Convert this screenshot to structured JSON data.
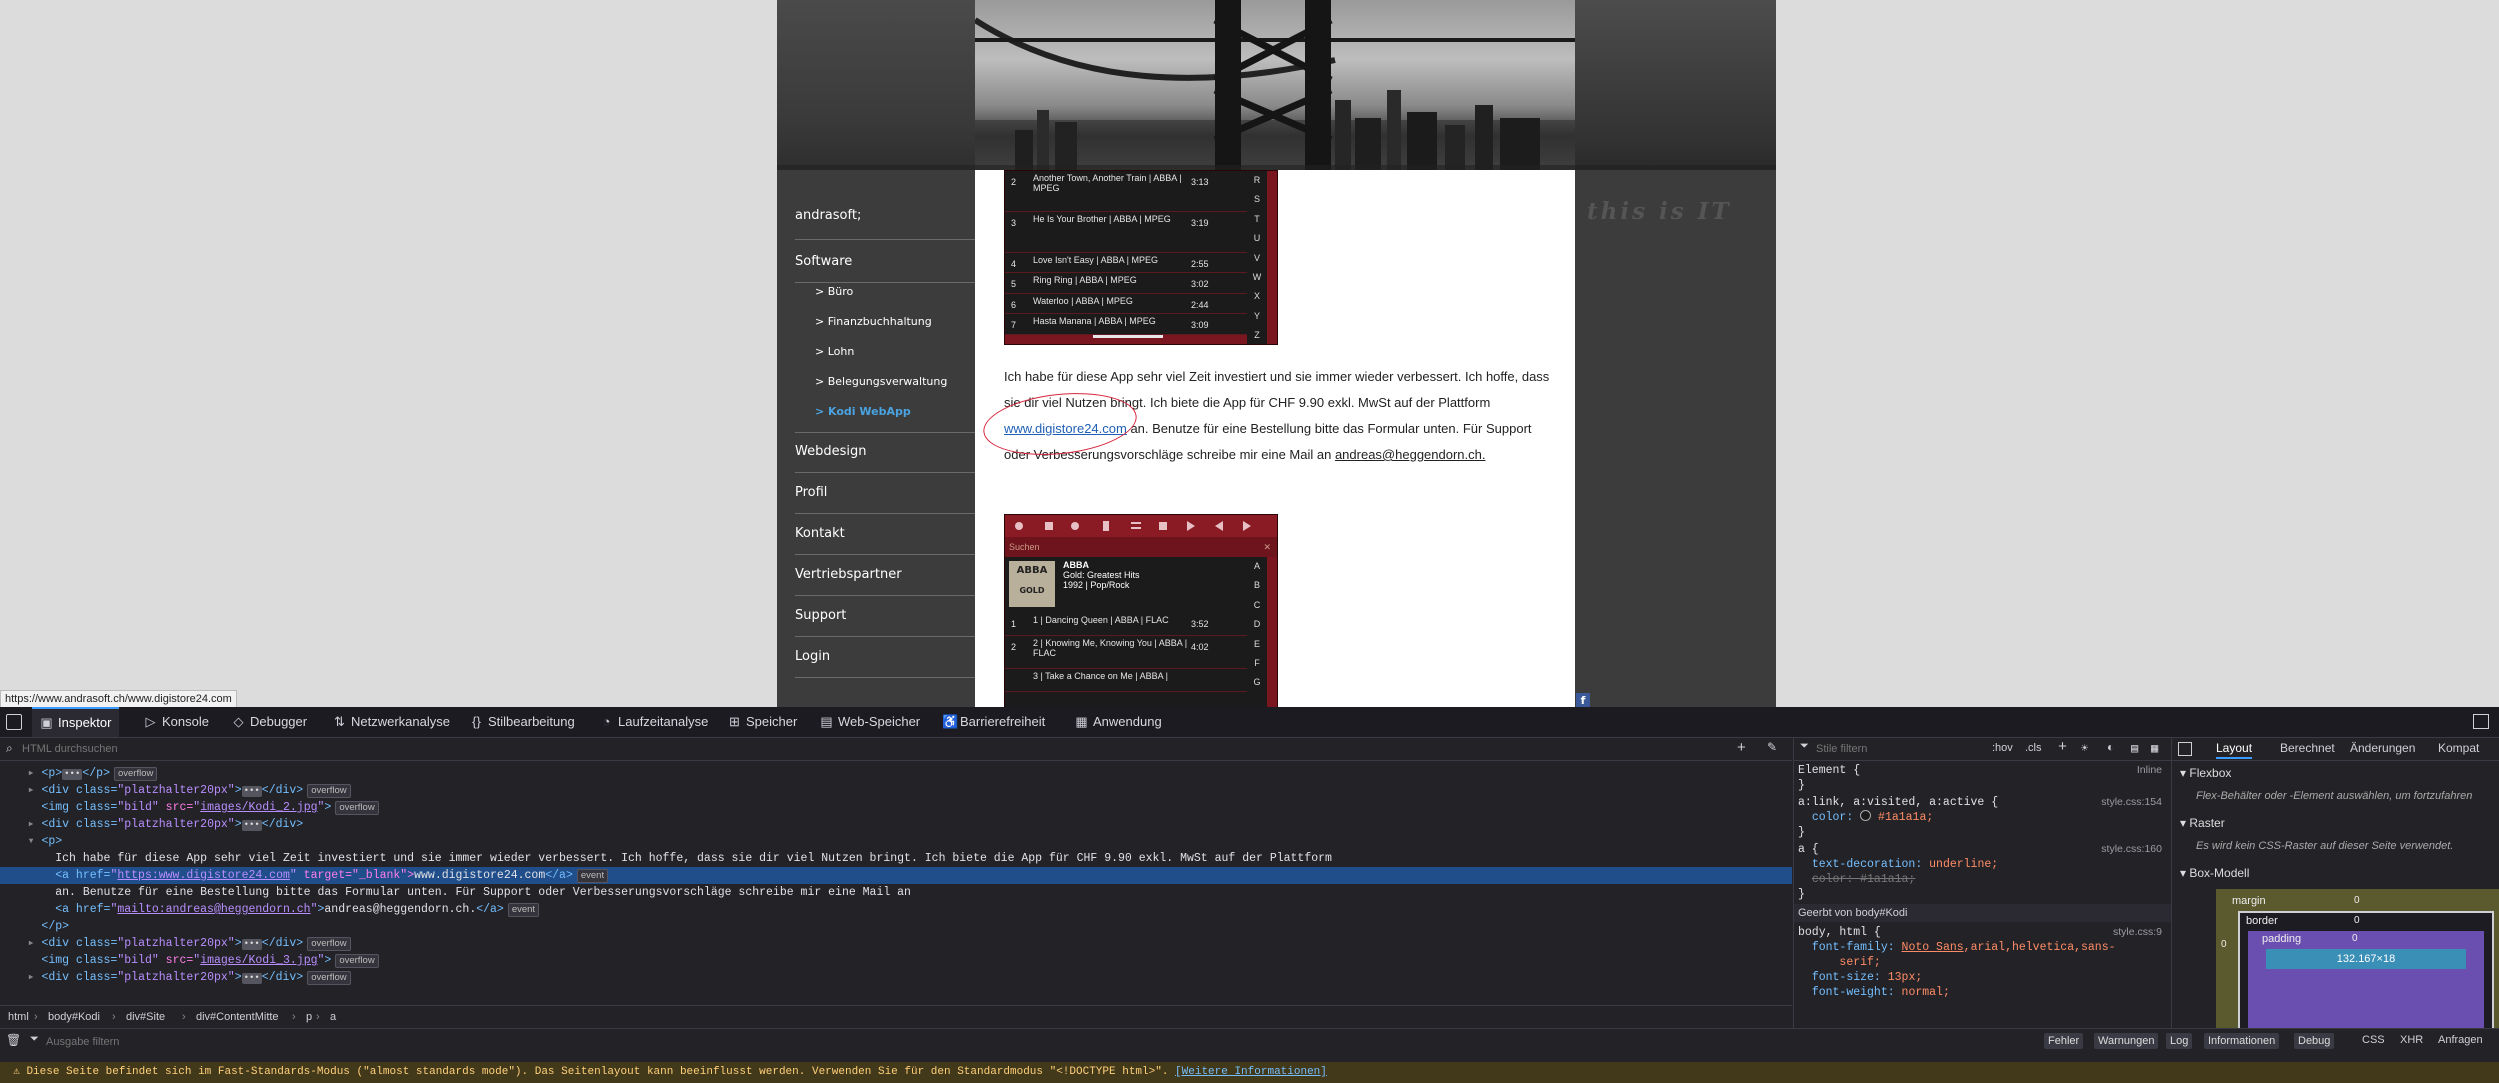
{
  "status_url": "https://www.andrasoft.ch/www.digistore24.com",
  "tagline": "this is IT",
  "sidebar": {
    "brand": "andrasoft;",
    "items": [
      {
        "label": "Software"
      },
      {
        "label": "Webdesign"
      },
      {
        "label": "Profil"
      },
      {
        "label": "Kontakt"
      },
      {
        "label": "Vertriebspartner"
      },
      {
        "label": "Support"
      },
      {
        "label": "Login"
      }
    ],
    "subitems": [
      {
        "label": "> Büro"
      },
      {
        "label": "> Finanzbuchhaltung"
      },
      {
        "label": "> Lohn"
      },
      {
        "label": "> Belegungsverwaltung"
      },
      {
        "label": "> Kodi WebApp"
      }
    ]
  },
  "kodi1": {
    "tracks": [
      {
        "n": "2",
        "title": "Another Town, Another Train | ABBA | MPEG",
        "dur": "3:13"
      },
      {
        "n": "3",
        "title": "He Is Your Brother | ABBA | MPEG",
        "dur": "3:19"
      },
      {
        "n": "4",
        "title": "Love Isn't Easy | ABBA | MPEG",
        "dur": "2:55"
      },
      {
        "n": "5",
        "title": "Ring Ring | ABBA | MPEG",
        "dur": "3:02"
      },
      {
        "n": "6",
        "title": "Waterloo | ABBA | MPEG",
        "dur": "2:44"
      },
      {
        "n": "7",
        "title": "Hasta Manana | ABBA | MPEG",
        "dur": "3:09"
      }
    ],
    "letters": [
      "R",
      "S",
      "T",
      "U",
      "V",
      "W",
      "X",
      "Y",
      "Z"
    ]
  },
  "paragraph": {
    "text1": "Ich habe für diese App sehr viel Zeit investiert und sie immer wieder verbessert. Ich hoffe, dass sie dir viel Nutzen bringt. Ich biete die App für CHF 9.90 exkl. MwSt auf der Plattform ",
    "link": "www.digistore24.com",
    "text2": " an. Benutze für eine Bestellung bitte das Formular unten. Für Support oder Verbesserungsvorschläge schreibe mir eine Mail an ",
    "mail": "andreas@heggendorn.ch."
  },
  "kodi2": {
    "panel_label": "Suchen",
    "album": {
      "artist": "ABBA",
      "title": "Gold: Greatest Hits",
      "meta": "1992 | Pop/Rock",
      "cover_text": "ABBA",
      "cover_sub": "GOLD"
    },
    "tracks": [
      {
        "n": "1",
        "title": "1 | Dancing Queen | ABBA | FLAC",
        "dur": "3:52"
      },
      {
        "n": "2",
        "title": "2 | Knowing Me, Knowing You | ABBA | FLAC",
        "dur": "4:02"
      },
      {
        "n": "",
        "title": "3 | Take a Chance on Me | ABBA |",
        "dur": ""
      }
    ],
    "letters": [
      "A",
      "B",
      "C",
      "D",
      "E",
      "F",
      "G"
    ]
  },
  "devtools": {
    "tabs": [
      {
        "label": "Inspektor",
        "icon": "inspector-icon"
      },
      {
        "label": "Konsole",
        "icon": "console-icon"
      },
      {
        "label": "Debugger",
        "icon": "debugger-icon"
      },
      {
        "label": "Netzwerkanalyse",
        "icon": "network-icon"
      },
      {
        "label": "Stilbearbeitung",
        "icon": "style-editor-icon"
      },
      {
        "label": "Laufzeitanalyse",
        "icon": "performance-icon"
      },
      {
        "label": "Speicher",
        "icon": "memory-icon"
      },
      {
        "label": "Web-Speicher",
        "icon": "storage-icon"
      },
      {
        "label": "Barrierefreiheit",
        "icon": "accessibility-icon"
      },
      {
        "label": "Anwendung",
        "icon": "application-icon"
      }
    ],
    "html_search_placeholder": "HTML durchsuchen",
    "styles_filter_placeholder": "Stile filtern",
    "hov": ":hov",
    "cls": ".cls",
    "tree": {
      "overflow": "overflow",
      "event": "event",
      "l0": "<p>",
      "l0b": "</p>",
      "div_open": "<div class=",
      "div_class": "\"platzhalter20px\"",
      "div_close": "</div>",
      "img_open": "<img class=",
      "img_class": "\"bild\"",
      "img_src_attr": " src=",
      "img2": "images/Kodi_2.jpg",
      "img3": "images/Kodi_3.jpg",
      "p_open": "<p>",
      "p_close": "</p>",
      "p_text": "Ich habe für diese App sehr viel Zeit investiert und sie immer wieder verbessert. Ich hoffe, dass sie dir viel Nutzen bringt. Ich biete die App für CHF 9.90 exkl. MwSt auf der Plattform",
      "a_open": "<a href=",
      "a_href": "https:www.digistore24.com",
      "a_target": " target=\"_blank\">",
      "a_text": "www.digistore24.com",
      "a_close": "</a>",
      "text2": "an. Benutze für eine Bestellung bitte das Formular unten. Für Support oder Verbesserungsvorschläge schreibe mir eine Mail an",
      "mailto": "mailto:andreas@heggendorn.ch",
      "mail_text": "andreas@heggendorn.ch.",
      "lt": "<",
      "gt": ">"
    },
    "breadcrumb": [
      "html",
      "body#Kodi",
      "div#Site",
      "div#ContentMitte",
      "p",
      "a"
    ],
    "rules": {
      "element": "Element {",
      "inline": "Inline",
      "close": "}",
      "r1_sel": "a:link, a:visited, a:active",
      "r1_src": "style.css:154",
      "color_prop": "color:",
      "color_val": "#1a1a1a;",
      "r2_sel": "a",
      "r2_src": "style.css:160",
      "td_prop": "text-decoration:",
      "td_val": "underline;",
      "color_strike": "color: #1a1a1a;",
      "inherited": "Geerbt von body#Kodi",
      "r3_sel": "body, html",
      "r3_src": "style.css:9",
      "ff_prop": "font-family:",
      "ff_val": "Noto Sans",
      "ff_rest": ",arial,helvetica,sans-",
      "ff_rest2": "serif;",
      "fs_prop": "font-size:",
      "fs_val": "13px;",
      "fw_prop": "font-weight:",
      "fw_val": "normal;"
    },
    "layout_tabs": [
      "Layout",
      "Berechnet",
      "Änderungen",
      "Kompat"
    ],
    "flexbox": "Flexbox",
    "flexbox_hint": "Flex-Behälter oder -Element auswählen, um fortzufahren",
    "grid": "Raster",
    "grid_hint": "Es wird kein CSS-Raster auf dieser Seite verwendet.",
    "boxmodel": "Box-Modell",
    "box": {
      "margin": "margin",
      "border": "border",
      "padding": "padding",
      "zero": "0",
      "size": "132.167×18"
    },
    "console_filter_placeholder": "Ausgabe filtern",
    "console_buttons": [
      "Fehler",
      "Warnungen",
      "Log",
      "Informationen",
      "Debug"
    ],
    "console_types": [
      "CSS",
      "XHR",
      "Anfragen"
    ],
    "warning_text": "Diese Seite befindet sich im Fast-Standards-Modus (\"almost standards mode\"). Das Seitenlayout kann beeinflusst werden. Verwenden Sie für den Standardmodus \"<!DOCTYPE html>\".",
    "warning_link": "[Weitere Informationen]"
  }
}
